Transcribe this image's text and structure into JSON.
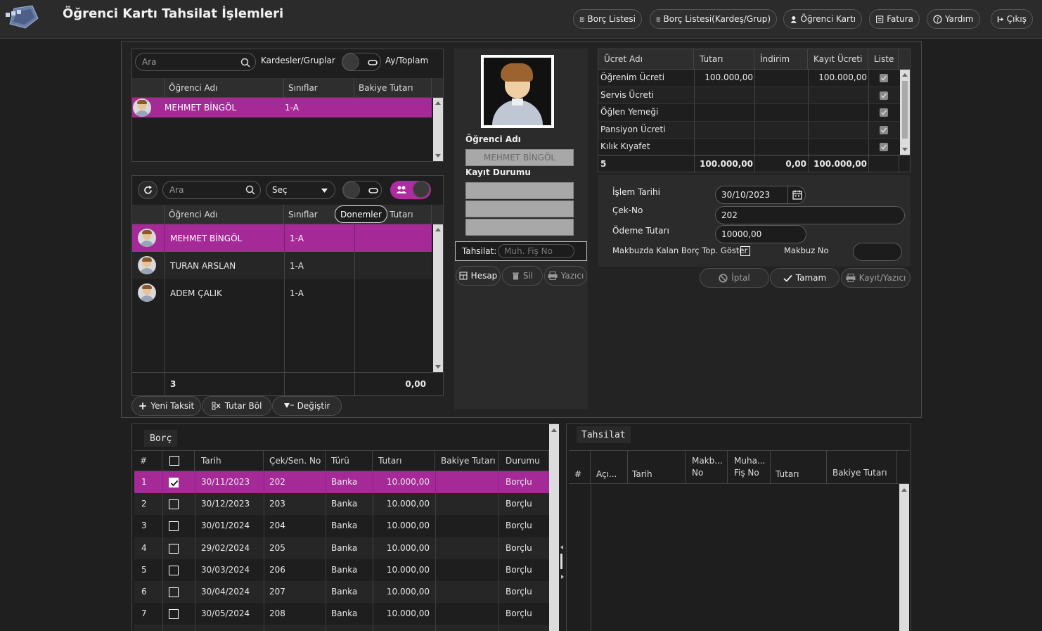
{
  "header": {
    "title": "Öğrenci Kartı Tahsilat İşlemleri",
    "buttons": [
      {
        "label": "Borç Listesi"
      },
      {
        "label": "Borç Listesi(Kardeş/Grup)"
      },
      {
        "label": "Öğrenci Kartı"
      },
      {
        "label": "Fatura"
      },
      {
        "label": "Yardım"
      },
      {
        "label": "Çıkış"
      }
    ]
  },
  "top_list": {
    "search_placeholder": "Ara",
    "toggle_left_label": "Kardesler/Gruplar",
    "toggle_right_label": "Ay/Toplam",
    "columns": [
      "Öğrenci Adı",
      "Sınıflar",
      "Bakiye Tutarı"
    ],
    "rows": [
      {
        "name": "MEHMET BİNGÖL",
        "class": "1-A",
        "balance": ""
      }
    ]
  },
  "student_list": {
    "search_placeholder": "Ara",
    "select_value": "Seç",
    "tooltip": "Donemler",
    "columns": [
      "Öğrenci Adı",
      "Sınıflar",
      "Bakiye Tutarı"
    ],
    "rows": [
      {
        "name": "MEHMET BİNGÖL",
        "class": "1-A",
        "balance": ""
      },
      {
        "name": "TURAN ARSLAN",
        "class": "1-A",
        "balance": ""
      },
      {
        "name": "ADEM ÇALIK",
        "class": "1-A",
        "balance": ""
      }
    ],
    "footer_count": "3",
    "footer_total": "0,00",
    "buttons": {
      "new_installment": "Yeni Taksit",
      "split": "Tutar Böl",
      "change": "Değiştir"
    }
  },
  "student_card": {
    "name_label": "Öğrenci Adı",
    "name_value": "MEHMET BİNGÖL",
    "status_label": "Kayıt Durumu",
    "tahsilat_label": "Tahsilat:",
    "tahsilat_placeholder": "Muh. Fiş No",
    "buttons": {
      "hesap": "Hesap",
      "sil": "Sil",
      "yazici": "Yazıcı"
    }
  },
  "fees": {
    "columns": [
      "Ücret Adı",
      "Tutarı",
      "İndirim",
      "Kayıt Ücreti",
      "Liste"
    ],
    "rows": [
      {
        "name": "Öğrenim Ücreti",
        "amount": "100.000,00",
        "discount": "",
        "reg": "100.000,00",
        "checked": true
      },
      {
        "name": "Servis Ücreti",
        "amount": "",
        "discount": "",
        "reg": "",
        "checked": true
      },
      {
        "name": "Öğlen Yemeği",
        "amount": "",
        "discount": "",
        "reg": "",
        "checked": true
      },
      {
        "name": "Pansiyon Ücreti",
        "amount": "",
        "discount": "",
        "reg": "",
        "checked": true
      },
      {
        "name": "Kılık Kıyafet",
        "amount": "",
        "discount": "",
        "reg": "",
        "checked": true
      }
    ],
    "footer": {
      "count": "5",
      "amount": "100.000,00",
      "discount": "0,00",
      "reg": "100.000,00"
    }
  },
  "payment_form": {
    "date_label": "İşlem Tarihi",
    "date_value": "30/10/2023",
    "cek_label": "Çek-No",
    "cek_value": "202",
    "amount_label": "Ödeme Tutarı",
    "amount_value": "10000,00",
    "show_label": "Makbuzda Kalan Borç Top. Göster",
    "makbuz_label": "Makbuz No",
    "makbuz_value": "",
    "buttons": {
      "cancel": "İptal",
      "ok": "Tamam",
      "save_print": "Kayıt/Yazıcı"
    }
  },
  "debt": {
    "title": "Borç",
    "columns": [
      "#",
      "",
      "Tarih",
      "Çek/Sen. No",
      "Türü",
      "Tutarı",
      "Bakiye Tutarı",
      "Durumu"
    ],
    "rows": [
      {
        "no": "1",
        "checked": true,
        "date": "30/11/2023",
        "cek": "202",
        "type": "Banka",
        "amount": "10.000,00",
        "balance": "",
        "status": "Borçlu"
      },
      {
        "no": "2",
        "checked": false,
        "date": "30/12/2023",
        "cek": "203",
        "type": "Banka",
        "amount": "10.000,00",
        "balance": "",
        "status": "Borçlu"
      },
      {
        "no": "3",
        "checked": false,
        "date": "30/01/2024",
        "cek": "204",
        "type": "Banka",
        "amount": "10.000,00",
        "balance": "",
        "status": "Borçlu"
      },
      {
        "no": "4",
        "checked": false,
        "date": "29/02/2024",
        "cek": "205",
        "type": "Banka",
        "amount": "10.000,00",
        "balance": "",
        "status": "Borçlu"
      },
      {
        "no": "5",
        "checked": false,
        "date": "30/03/2024",
        "cek": "206",
        "type": "Banka",
        "amount": "10.000,00",
        "balance": "",
        "status": "Borçlu"
      },
      {
        "no": "6",
        "checked": false,
        "date": "30/04/2024",
        "cek": "207",
        "type": "Banka",
        "amount": "10.000,00",
        "balance": "",
        "status": "Borçlu"
      },
      {
        "no": "7",
        "checked": false,
        "date": "30/05/2024",
        "cek": "208",
        "type": "Banka",
        "amount": "10.000,00",
        "balance": "",
        "status": "Borçlu"
      }
    ]
  },
  "collection": {
    "title": "Tahsilat",
    "columns": [
      "#",
      "Açı...",
      "Tarih",
      "Makb... No",
      "Muha... Fiş No",
      "Tutarı",
      "Bakiye Tutarı"
    ]
  },
  "colors": {
    "accent": "#a52a98",
    "background": "#1f1f1f",
    "panel": "#2a2a2a"
  }
}
